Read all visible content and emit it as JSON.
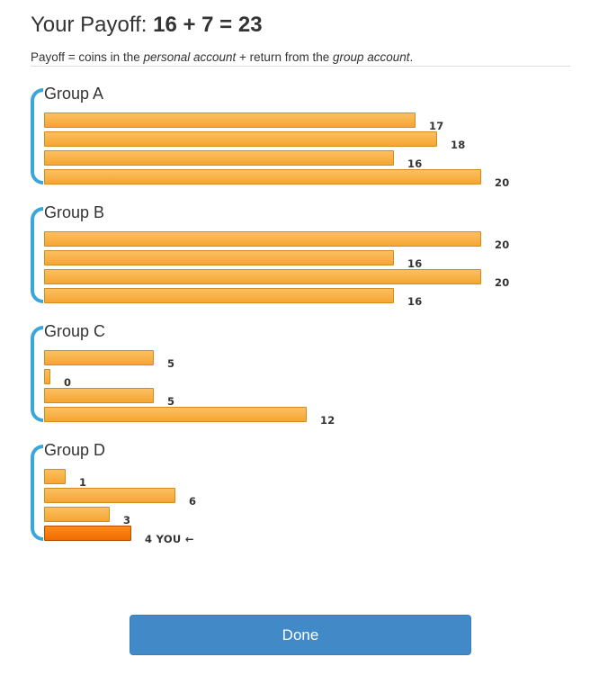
{
  "header": {
    "title_prefix": "Your Payoff: ",
    "title_equation": "16 + 7 = 23"
  },
  "subtitle": {
    "part1": "Payoff = coins in the ",
    "personal_account": "personal account",
    "part2": " + return from the ",
    "group_account": "group account",
    "part3": "."
  },
  "max_value": 20,
  "groups": [
    {
      "name": "Group A",
      "members": [
        {
          "label": "17",
          "value": 17,
          "you": false
        },
        {
          "label": "18",
          "value": 18,
          "you": false
        },
        {
          "label": "16",
          "value": 16,
          "you": false
        },
        {
          "label": "20",
          "value": 20,
          "you": false
        }
      ]
    },
    {
      "name": "Group B",
      "members": [
        {
          "label": "20",
          "value": 20,
          "you": false
        },
        {
          "label": "16",
          "value": 16,
          "you": false
        },
        {
          "label": "20",
          "value": 20,
          "you": false
        },
        {
          "label": "16",
          "value": 16,
          "you": false
        }
      ]
    },
    {
      "name": "Group C",
      "members": [
        {
          "label": "5",
          "value": 5,
          "you": false
        },
        {
          "label": "0",
          "value": 0,
          "you": false
        },
        {
          "label": "5",
          "value": 5,
          "you": false
        },
        {
          "label": "12",
          "value": 12,
          "you": false
        }
      ]
    },
    {
      "name": "Group D",
      "members": [
        {
          "label": "1",
          "value": 1,
          "you": false
        },
        {
          "label": "6",
          "value": 6,
          "you": false
        },
        {
          "label": "3",
          "value": 3,
          "you": false
        },
        {
          "label": "4 YOU ←",
          "value": 4,
          "you": true
        }
      ]
    }
  ],
  "colors": {
    "bar": "#f6a532",
    "bar_you": "#f06c00",
    "bracket": "#3aa6d9",
    "button": "#4189c7"
  },
  "done_button": {
    "label": "Done"
  }
}
